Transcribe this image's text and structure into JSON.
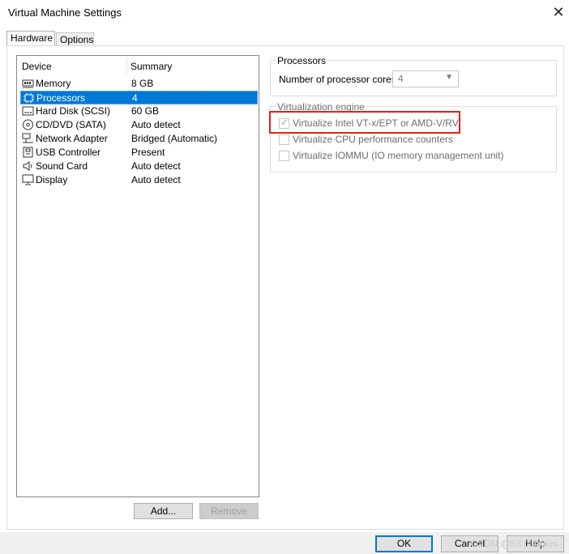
{
  "window": {
    "title": "Virtual Machine Settings"
  },
  "tabs": [
    {
      "label": "Hardware",
      "active": true
    },
    {
      "label": "Options",
      "active": false
    }
  ],
  "device_list": {
    "columns": [
      "Device",
      "Summary"
    ],
    "rows": [
      {
        "device": "Memory",
        "summary": "8 GB",
        "icon": "memory-icon",
        "selected": false
      },
      {
        "device": "Processors",
        "summary": "4",
        "icon": "processor-icon",
        "selected": true
      },
      {
        "device": "Hard Disk (SCSI)",
        "summary": "60 GB",
        "icon": "hard-disk-icon",
        "selected": false
      },
      {
        "device": "CD/DVD (SATA)",
        "summary": "Auto detect",
        "icon": "cd-dvd-icon",
        "selected": false
      },
      {
        "device": "Network Adapter",
        "summary": "Bridged (Automatic)",
        "icon": "network-adapter-icon",
        "selected": false
      },
      {
        "device": "USB Controller",
        "summary": "Present",
        "icon": "usb-icon",
        "selected": false
      },
      {
        "device": "Sound Card",
        "summary": "Auto detect",
        "icon": "sound-card-icon",
        "selected": false
      },
      {
        "device": "Display",
        "summary": "Auto detect",
        "icon": "display-icon",
        "selected": false
      }
    ]
  },
  "list_buttons": {
    "add": "Add...",
    "remove": "Remove"
  },
  "processors": {
    "group_label": "Processors",
    "cores_label": "Number of processor cores:",
    "cores_value": "4"
  },
  "virtualization": {
    "group_label": "Virtualization engine",
    "options": [
      {
        "label": "Virtualize Intel VT-x/EPT or AMD-V/RVI",
        "checked": true
      },
      {
        "label": "Virtualize CPU performance counters",
        "checked": false
      },
      {
        "label": "Virtualize IOMMU (IO memory management unit)",
        "checked": false
      }
    ]
  },
  "footer_buttons": {
    "ok": "OK",
    "cancel": "Cancel",
    "help": "Help"
  },
  "watermark": "CSDN @53 dahuies",
  "colors": {
    "selection": "#0078d7",
    "highlight_box": "#e0221a"
  }
}
